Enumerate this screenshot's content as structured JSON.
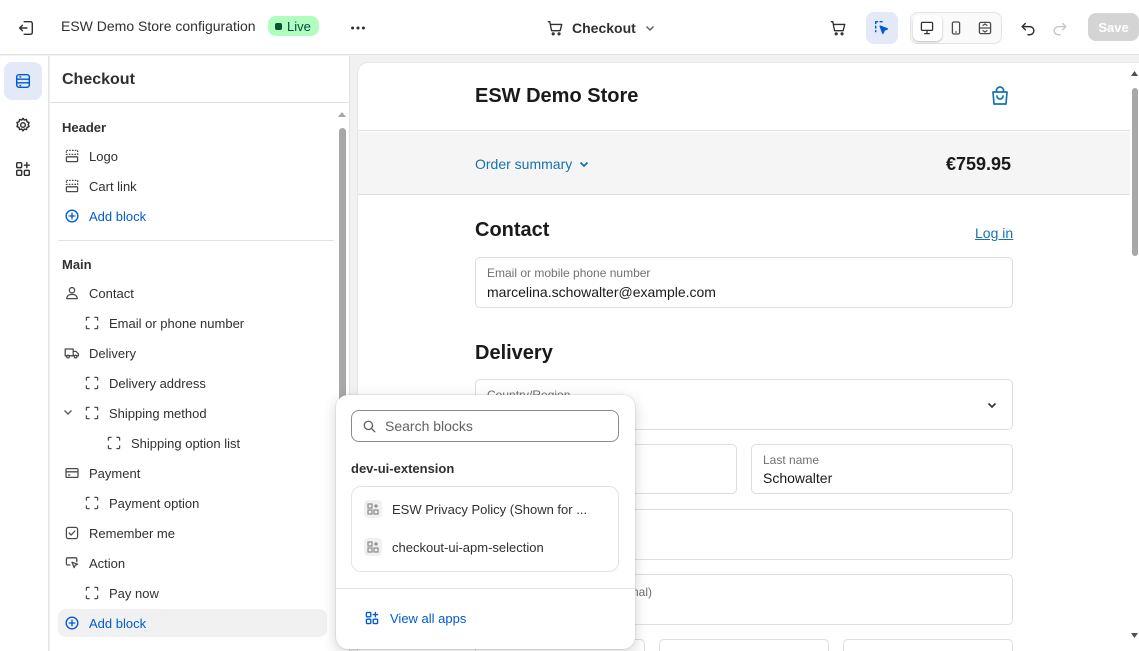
{
  "topbar": {
    "title": "ESW Demo Store configuration",
    "status": "Live",
    "page_selector": "Checkout",
    "save_label": "Save"
  },
  "panel": {
    "title": "Checkout",
    "header_section": {
      "title": "Header",
      "items": [
        {
          "label": "Logo",
          "icon": "layout-section-icon"
        },
        {
          "label": "Cart link",
          "icon": "layout-section-icon"
        },
        {
          "label": "Add block",
          "icon": "plus-circle-icon"
        }
      ]
    },
    "main_section": {
      "title": "Main",
      "items": [
        {
          "label": "Contact",
          "icon": "person-icon"
        },
        {
          "label": "Email or phone number",
          "icon": "block-icon"
        },
        {
          "label": "Delivery",
          "icon": "truck-icon"
        },
        {
          "label": "Delivery address",
          "icon": "block-icon"
        },
        {
          "label": "Shipping method",
          "icon": "block-icon"
        },
        {
          "label": "Shipping option list",
          "icon": "block-icon"
        },
        {
          "label": "Payment",
          "icon": "credit-card-icon"
        },
        {
          "label": "Payment option",
          "icon": "block-icon"
        },
        {
          "label": "Remember me",
          "icon": "checkbox-icon"
        },
        {
          "label": "Action",
          "icon": "cursor-icon"
        },
        {
          "label": "Pay now",
          "icon": "block-icon"
        },
        {
          "label": "Add block",
          "icon": "plus-circle-icon"
        }
      ]
    }
  },
  "preview": {
    "store_name": "ESW Demo Store",
    "order_summary": "Order summary",
    "total": "€759.95",
    "contact_heading": "Contact",
    "login_link": "Log in",
    "email_label": "Email or mobile phone number",
    "email_value": "marcelina.schowalter@example.com",
    "delivery_heading": "Delivery",
    "country_label": "Country/Region",
    "last_name_label": "Last name",
    "last_name_value": "Schowalter",
    "optional_suffix": "nal)"
  },
  "popover": {
    "search_placeholder": "Search blocks",
    "group_title": "dev-ui-extension",
    "items": [
      {
        "label": "ESW Privacy Policy (Shown for ..."
      },
      {
        "label": "checkout-ui-apm-selection"
      }
    ],
    "view_all": "View all apps"
  },
  "colors": {
    "accent": "#005bd3",
    "link": "#1773b0",
    "live_bg": "#affebf"
  }
}
